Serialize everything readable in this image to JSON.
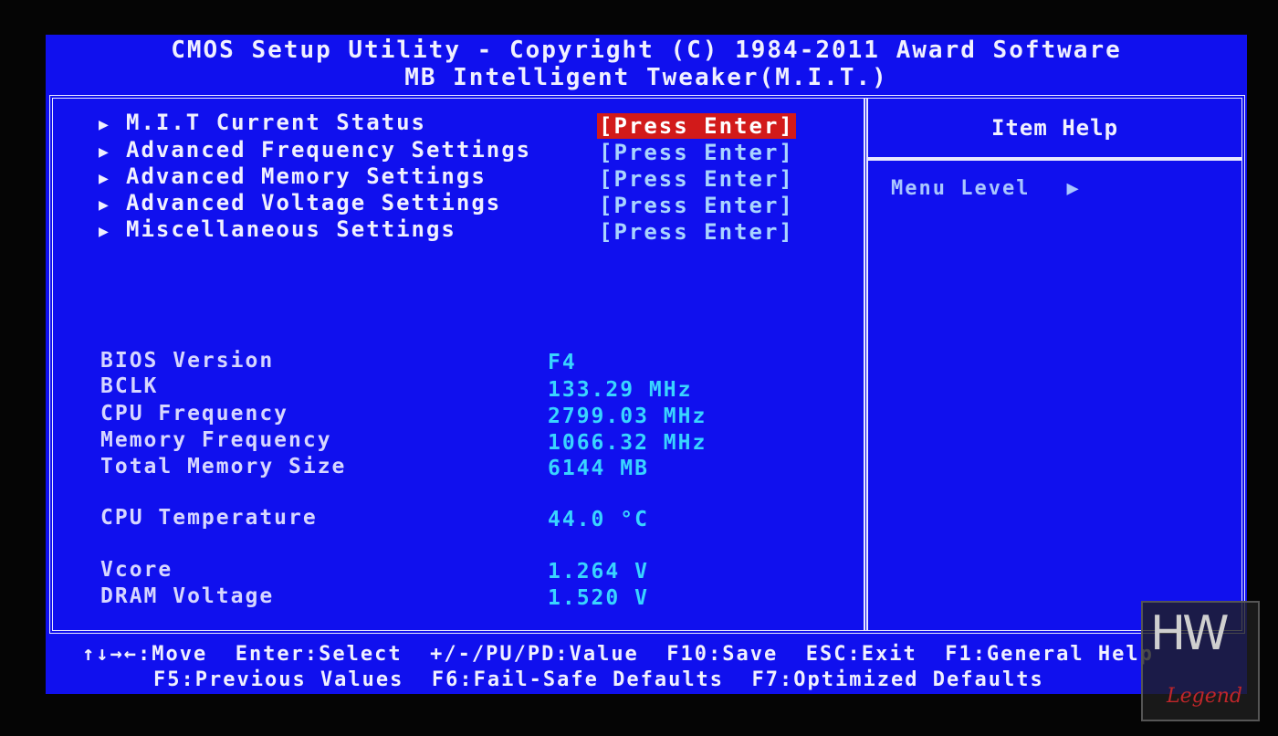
{
  "header": {
    "title": "CMOS Setup Utility - Copyright (C) 1984-2011 Award Software",
    "subtitle": "MB Intelligent Tweaker(M.I.T.)"
  },
  "menu": {
    "items": [
      {
        "label": "M.I.T Current Status",
        "action": "[Press Enter]"
      },
      {
        "label": "Advanced Frequency Settings",
        "action": "[Press Enter]"
      },
      {
        "label": "Advanced Memory Settings",
        "action": "[Press Enter]"
      },
      {
        "label": "Advanced Voltage Settings",
        "action": "[Press Enter]"
      },
      {
        "label": "Miscellaneous Settings",
        "action": "[Press Enter]"
      }
    ],
    "selected_index": 0
  },
  "info": {
    "rows": [
      {
        "label": "BIOS Version",
        "value": "F4"
      },
      {
        "label": "BCLK",
        "value": "133.29 MHz"
      },
      {
        "label": "CPU Frequency",
        "value": "2799.03 MHz"
      },
      {
        "label": "Memory Frequency",
        "value": "1066.32 MHz"
      },
      {
        "label": "Total Memory Size",
        "value": "6144 MB"
      },
      {
        "label": "CPU Temperature",
        "value": "44.0 °C"
      },
      {
        "label": "Vcore",
        "value": "1.264 V"
      },
      {
        "label": "DRAM Voltage",
        "value": "1.520 V"
      }
    ]
  },
  "help": {
    "title": "Item Help",
    "menu_level": "Menu Level",
    "arrow": "▶"
  },
  "footer": {
    "line1": "↑↓→←:Move  Enter:Select  +/-/PU/PD:Value  F10:Save  ESC:Exit  F1:General Help",
    "line2": "F5:Previous Values  F6:Fail-Safe Defaults  F7:Optimized Defaults"
  },
  "watermark": {
    "mark": "HW",
    "word": "Legend"
  },
  "colors": {
    "background": "#1010ee",
    "highlight": "#d21a1a",
    "value": "#39d4ff"
  },
  "icons": {
    "submenu": "triangle-right-icon"
  }
}
